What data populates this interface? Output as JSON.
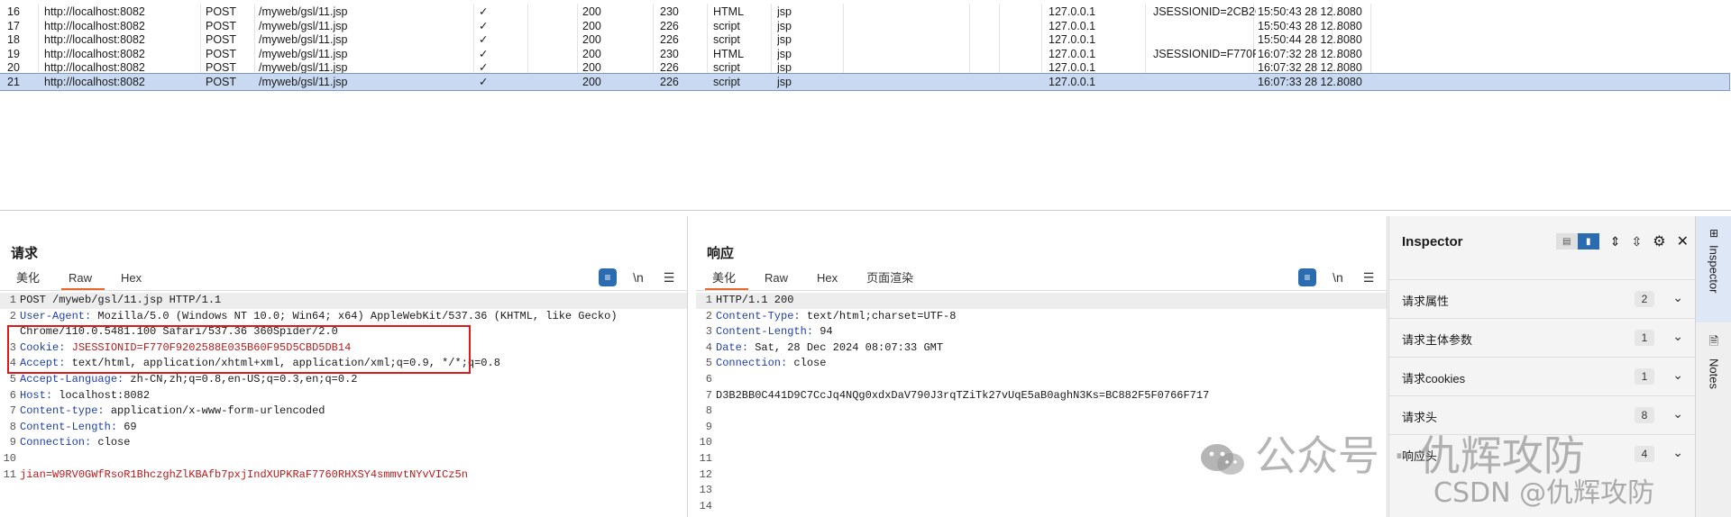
{
  "history": {
    "rows": [
      {
        "num": "16",
        "host": "http://localhost:8082",
        "method": "POST",
        "url": "/myweb/gsl/11.jsp",
        "edited": "✓",
        "status": "200",
        "length": "230",
        "mime": "HTML",
        "ext": "jsp",
        "ip": "127.0.0.1",
        "cookies": "JSESSIONID=2CB2C...",
        "time": "15:50:43 28 12...",
        "port": "8080",
        "selected": false
      },
      {
        "num": "17",
        "host": "http://localhost:8082",
        "method": "POST",
        "url": "/myweb/gsl/11.jsp",
        "edited": "✓",
        "status": "200",
        "length": "226",
        "mime": "script",
        "ext": "jsp",
        "ip": "127.0.0.1",
        "cookies": "",
        "time": "15:50:43 28 12...",
        "port": "8080",
        "selected": false
      },
      {
        "num": "18",
        "host": "http://localhost:8082",
        "method": "POST",
        "url": "/myweb/gsl/11.jsp",
        "edited": "✓",
        "status": "200",
        "length": "226",
        "mime": "script",
        "ext": "jsp",
        "ip": "127.0.0.1",
        "cookies": "",
        "time": "15:50:44 28 12...",
        "port": "8080",
        "selected": false
      },
      {
        "num": "19",
        "host": "http://localhost:8082",
        "method": "POST",
        "url": "/myweb/gsl/11.jsp",
        "edited": "✓",
        "status": "200",
        "length": "230",
        "mime": "HTML",
        "ext": "jsp",
        "ip": "127.0.0.1",
        "cookies": "JSESSIONID=F770F...",
        "time": "16:07:32 28 12...",
        "port": "8080",
        "selected": false
      },
      {
        "num": "20",
        "host": "http://localhost:8082",
        "method": "POST",
        "url": "/myweb/gsl/11.jsp",
        "edited": "✓",
        "status": "200",
        "length": "226",
        "mime": "script",
        "ext": "jsp",
        "ip": "127.0.0.1",
        "cookies": "",
        "time": "16:07:32 28 12...",
        "port": "8080",
        "selected": false
      },
      {
        "num": "21",
        "host": "http://localhost:8082",
        "method": "POST",
        "url": "/myweb/gsl/11.jsp",
        "edited": "✓",
        "status": "200",
        "length": "226",
        "mime": "script",
        "ext": "jsp",
        "ip": "127.0.0.1",
        "cookies": "",
        "time": "16:07:33 28 12...",
        "port": "8080",
        "selected": true
      }
    ]
  },
  "request": {
    "title": "请求",
    "tabs": [
      "美化",
      "Raw",
      "Hex"
    ],
    "active_tab": "Raw",
    "newline_icon": "\\n",
    "lines": [
      {
        "n": "1",
        "key": "",
        "val": "POST /myweb/gsl/11.jsp HTTP/1.1",
        "hl": true
      },
      {
        "n": "2",
        "key": "User-Agent",
        "val": " Mozilla/5.0 (Windows NT 10.0; Win64; x64) AppleWebKit/537.36 (KHTML, like Gecko)",
        "hl": false
      },
      {
        "n": "",
        "key": "",
        "val": "Chrome/110.0.5481.100 Safari/537.36 360Spider/2.0",
        "hl": false
      },
      {
        "n": "3",
        "key": "Cookie",
        "val": " JSESSIONID=F770F9202588E035B60F95D5CBD5DB14",
        "hl": false,
        "cookie": true
      },
      {
        "n": "4",
        "key": "Accept",
        "val": " text/html, application/xhtml+xml, application/xml;q=0.9, */*;q=0.8",
        "hl": false
      },
      {
        "n": "5",
        "key": "Accept-Language",
        "val": " zh-CN,zh;q=0.8,en-US;q=0.3,en;q=0.2",
        "hl": false
      },
      {
        "n": "6",
        "key": "Host",
        "val": " localhost:8082",
        "hl": false
      },
      {
        "n": "7",
        "key": "Content-type",
        "val": " application/x-www-form-urlencoded",
        "hl": false
      },
      {
        "n": "8",
        "key": "Content-Length",
        "val": " 69",
        "hl": false
      },
      {
        "n": "9",
        "key": "Connection",
        "val": " close",
        "hl": false
      },
      {
        "n": "10",
        "key": "",
        "val": "",
        "hl": false
      },
      {
        "n": "11",
        "key": "jian",
        "val": "=W9RV0GWfRsoR1BhczghZlKBAfb7pxjIndXUPKRaF7760RHXSY4smmvtNYvVICz5n",
        "hl": false,
        "param": true
      }
    ]
  },
  "response": {
    "title": "响应",
    "tabs": [
      "美化",
      "Raw",
      "Hex",
      "页面渲染"
    ],
    "active_tab": "美化",
    "newline_icon": "\\n",
    "lines": [
      {
        "n": "1",
        "key": "",
        "val": "HTTP/1.1 200",
        "hl": true
      },
      {
        "n": "2",
        "key": "Content-Type",
        "val": " text/html;charset=UTF-8",
        "hl": false
      },
      {
        "n": "3",
        "key": "Content-Length",
        "val": " 94",
        "hl": false
      },
      {
        "n": "4",
        "key": "Date",
        "val": " Sat, 28 Dec 2024 08:07:33 GMT",
        "hl": false
      },
      {
        "n": "5",
        "key": "Connection",
        "val": " close",
        "hl": false
      },
      {
        "n": "6",
        "key": "",
        "val": "",
        "hl": false
      },
      {
        "n": "7",
        "key": "",
        "val": "D3B2BB0C441D9C7CcJq4NQg0xdxDaV790J3rqTZiTk27vUqE5aB0aghN3Ks=BC882F5F0766F717",
        "hl": false
      },
      {
        "n": "8",
        "key": "",
        "val": "",
        "hl": false
      },
      {
        "n": "9",
        "key": "",
        "val": "",
        "hl": false
      },
      {
        "n": "10",
        "key": "",
        "val": "",
        "hl": false
      },
      {
        "n": "11",
        "key": "",
        "val": "",
        "hl": false
      },
      {
        "n": "12",
        "key": "",
        "val": "",
        "hl": false
      },
      {
        "n": "13",
        "key": "",
        "val": "",
        "hl": false
      },
      {
        "n": "14",
        "key": "",
        "val": "",
        "hl": false
      }
    ]
  },
  "inspector": {
    "title": "Inspector",
    "sections": [
      {
        "label": "请求属性",
        "count": "2"
      },
      {
        "label": "请求主体参数",
        "count": "1"
      },
      {
        "label": "请求cookies",
        "count": "1"
      },
      {
        "label": "请求头",
        "count": "8"
      },
      {
        "label": "响应头",
        "count": "4"
      }
    ]
  },
  "side_tabs": [
    "Inspector",
    "Notes"
  ],
  "watermark": {
    "main": "公众号 · 仇辉攻防",
    "sub": "CSDN @仇辉攻防"
  },
  "colors": {
    "accent": "#e8672b",
    "selection": "#c9d9f1",
    "blue": "#2b6cb0",
    "key": "#1f3fa8",
    "value": "#b81b1b",
    "highlight_box": "#e01818"
  }
}
